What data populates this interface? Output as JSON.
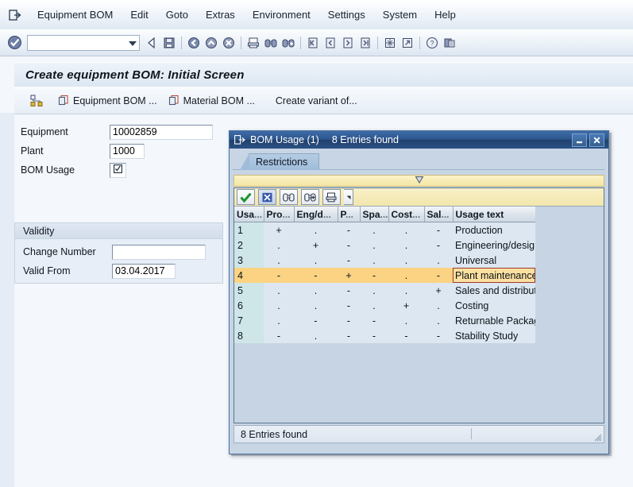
{
  "menu": {
    "system_icon": "exit-arrow-icon",
    "items": [
      {
        "label": "Equipment BOM",
        "accel_index": 1
      },
      {
        "label": "Edit",
        "accel_index": 0
      },
      {
        "label": "Goto",
        "accel_index": 0
      },
      {
        "label": "Extras",
        "accel_index": 4
      },
      {
        "label": "Environment",
        "accel_index": 0
      },
      {
        "label": "Settings",
        "accel_index": 0
      },
      {
        "label": "System",
        "accel_index": 1
      },
      {
        "label": "Help",
        "accel_index": 0
      }
    ]
  },
  "toolbar": {
    "enter_icon": "green-check-enter-icon",
    "command_field_value": "",
    "command_field_placeholder": "",
    "dropdown_icon": "chevron-down-icon",
    "buttons": [
      {
        "name": "back-icon",
        "glyph": "◁"
      },
      {
        "name": "save-icon",
        "glyph": "floppy"
      },
      {
        "name": "sep",
        "glyph": "|"
      },
      {
        "name": "back-green-icon",
        "glyph": "left-arrow-circle"
      },
      {
        "name": "exit-yellow-icon",
        "glyph": "up-arrow-circle"
      },
      {
        "name": "cancel-icon",
        "glyph": "x-circle"
      },
      {
        "name": "sep",
        "glyph": "|"
      },
      {
        "name": "print-icon",
        "glyph": "printer"
      },
      {
        "name": "find-icon",
        "glyph": "binoculars"
      },
      {
        "name": "find-next-icon",
        "glyph": "binoculars-plus"
      },
      {
        "name": "sep",
        "glyph": "|"
      },
      {
        "name": "first-page-icon",
        "glyph": "page-first"
      },
      {
        "name": "previous-page-icon",
        "glyph": "page-prev"
      },
      {
        "name": "next-page-icon",
        "glyph": "page-next"
      },
      {
        "name": "last-page-icon",
        "glyph": "page-last"
      },
      {
        "name": "sep",
        "glyph": "|"
      },
      {
        "name": "create-session-icon",
        "glyph": "new-session"
      },
      {
        "name": "create-shortcut-icon",
        "glyph": "shortcut"
      },
      {
        "name": "sep",
        "glyph": "|"
      },
      {
        "name": "help-icon",
        "glyph": "question-circle"
      },
      {
        "name": "customize-layout-icon",
        "glyph": "layout"
      }
    ]
  },
  "screen": {
    "title": "Create equipment BOM: Initial Screen",
    "app_toolbar": {
      "leading_icon": "bom-structure-icon",
      "buttons": [
        {
          "label": "Equipment BOM ...",
          "icon": "copy-icon"
        },
        {
          "label": "Material BOM ...",
          "icon": "copy-icon"
        },
        {
          "label": "Create variant of...",
          "icon": ""
        }
      ]
    }
  },
  "form": {
    "fields": [
      {
        "label": "Equipment",
        "value": "10002859",
        "name": "equipment-field"
      },
      {
        "label": "Plant",
        "value": "1000",
        "name": "plant-field"
      },
      {
        "label": "BOM Usage",
        "value": "☑",
        "name": "bom-usage-field"
      }
    ],
    "validity": {
      "title": "Validity",
      "fields": [
        {
          "label": "Change Number",
          "value": "",
          "name": "change-number-field"
        },
        {
          "label": "Valid From",
          "value": "03.04.2017",
          "name": "valid-from-field"
        }
      ]
    }
  },
  "dialog": {
    "icon": "exit-arrow-icon",
    "title": "BOM Usage (1)",
    "subtitle": "8 Entries found",
    "minimize_icon": "minimize-icon",
    "close_icon": "close-icon",
    "tab": "Restrictions",
    "filter_icon": "filter-collapse-icon",
    "toolbar": [
      {
        "name": "copy-selection-button",
        "icon": "green-check-icon"
      },
      {
        "name": "cancel-button",
        "icon": "blue-x-icon"
      },
      {
        "name": "find-button",
        "icon": "binoculars-icon"
      },
      {
        "name": "find-next-button",
        "icon": "binoculars-plus-icon"
      },
      {
        "name": "print-button",
        "icon": "printer-icon"
      },
      {
        "name": "more-options-button",
        "icon": "dropdown-arrow-icon"
      }
    ],
    "table": {
      "columns": [
        {
          "label": "Usa",
          "truncated": true,
          "width": 37
        },
        {
          "label": "Pro",
          "truncated": true,
          "width": 38
        },
        {
          "label": "Eng/d",
          "truncated": true,
          "width": 55
        },
        {
          "label": "P",
          "truncated": true,
          "width": 28
        },
        {
          "label": "Spa",
          "truncated": true,
          "width": 36
        },
        {
          "label": "Cost",
          "truncated": true,
          "width": 45
        },
        {
          "label": "Sal",
          "truncated": true,
          "width": 36
        },
        {
          "label": "Usage text",
          "truncated": false,
          "width": 104
        }
      ],
      "rows": [
        {
          "usa": "1",
          "pro": "+",
          "eng": ".",
          "p": "-",
          "spa": ".",
          "cost": ".",
          "sal": "-",
          "text": "Production",
          "selected": false
        },
        {
          "usa": "2",
          "pro": ".",
          "eng": "+",
          "p": "-",
          "spa": ".",
          "cost": ".",
          "sal": "-",
          "text": "Engineering/design",
          "selected": false
        },
        {
          "usa": "3",
          "pro": ".",
          "eng": ".",
          "p": "-",
          "spa": ".",
          "cost": ".",
          "sal": ".",
          "text": "Universal",
          "selected": false
        },
        {
          "usa": "4",
          "pro": "-",
          "eng": "-",
          "p": "+",
          "spa": "-",
          "cost": ".",
          "sal": "-",
          "text": "Plant maintenance",
          "selected": true
        },
        {
          "usa": "5",
          "pro": ".",
          "eng": ".",
          "p": "-",
          "spa": ".",
          "cost": ".",
          "sal": "+",
          "text": "Sales and distribution",
          "selected": false
        },
        {
          "usa": "6",
          "pro": ".",
          "eng": ".",
          "p": "-",
          "spa": ".",
          "cost": "+",
          "sal": ".",
          "text": "Costing",
          "selected": false
        },
        {
          "usa": "7",
          "pro": ".",
          "eng": "-",
          "p": "-",
          "spa": "-",
          "cost": ".",
          "sal": ".",
          "text": "Returnable Packaging",
          "selected": false
        },
        {
          "usa": "8",
          "pro": "-",
          "eng": ".",
          "p": "-",
          "spa": "-",
          "cost": "-",
          "sal": "-",
          "text": "Stability Study",
          "selected": false
        }
      ]
    },
    "status": "8 Entries found",
    "resize_grip": "resize-grip-icon"
  },
  "colors": {
    "dialog_title_start": "#3f6ca8",
    "dialog_title_end": "#20406d",
    "selection_row": "#fbd382",
    "selection_cell_border": "#9e3a30",
    "index_column": "#cfe6e8",
    "row_background": "#dde7f1",
    "filter_bar": "#f4e6a3",
    "window_background": "#eef3f9"
  }
}
